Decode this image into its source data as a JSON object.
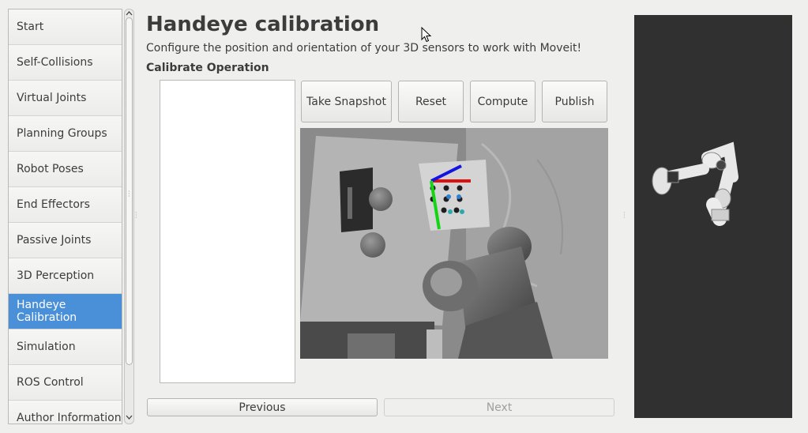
{
  "sidebar": {
    "items": [
      {
        "label": "Start"
      },
      {
        "label": "Self-Collisions"
      },
      {
        "label": "Virtual Joints"
      },
      {
        "label": "Planning Groups"
      },
      {
        "label": "Robot Poses"
      },
      {
        "label": "End Effectors"
      },
      {
        "label": "Passive Joints"
      },
      {
        "label": "3D Perception"
      },
      {
        "label": "Handeye Calibration",
        "active": true
      },
      {
        "label": "Simulation"
      },
      {
        "label": "ROS Control"
      },
      {
        "label": "Author Information"
      }
    ]
  },
  "main": {
    "title": "Handeye calibration",
    "description": "Configure the position and orientation of your 3D sensors to work with Moveit!",
    "section_label": "Calibrate Operation",
    "buttons": {
      "take_snapshot": "Take Snapshot",
      "reset": "Reset",
      "compute": "Compute",
      "publish": "Publish"
    }
  },
  "footer": {
    "previous": "Previous",
    "next": "Next"
  },
  "colors": {
    "accent": "#4a90d9",
    "viewport_bg": "#303030"
  },
  "icons": {
    "cursor": "mouse-pointer-icon",
    "scroll_up": "chevron-up-icon",
    "scroll_down": "chevron-down-icon"
  }
}
